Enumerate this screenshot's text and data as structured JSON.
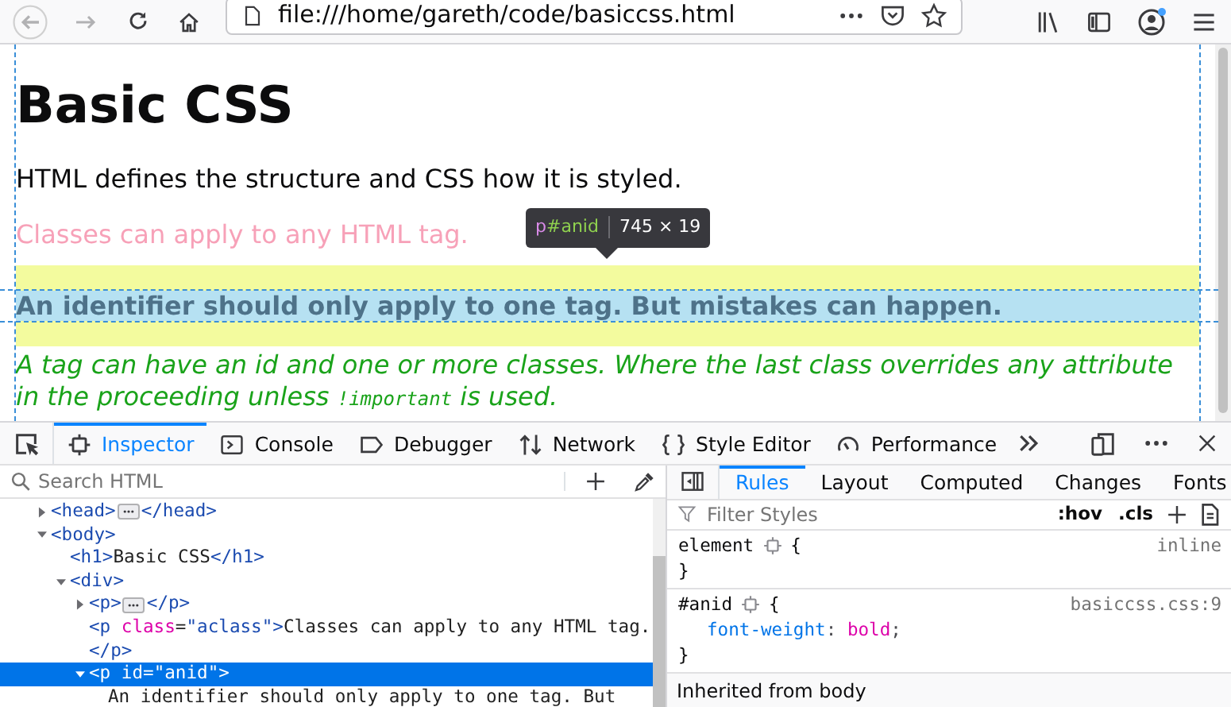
{
  "browser": {
    "url": "file:///home/gareth/code/basiccss.html"
  },
  "page": {
    "heading": "Basic CSS",
    "paragraphs": [
      {
        "kind": "plain",
        "text": "HTML defines the structure and CSS how it is styled."
      },
      {
        "kind": "class",
        "text": "Classes can apply to any HTML tag."
      },
      {
        "kind": "id",
        "text": "An identifier should only apply to one tag. But mistakes can happen.",
        "highlighted": true
      },
      {
        "kind": "mixed",
        "parts": [
          {
            "kind": "text",
            "text": "A tag can have an id and one or more classes. Where the last class overrides any attribute in the proceeding unless "
          },
          {
            "kind": "code",
            "text": "!important"
          },
          {
            "kind": "text",
            "text": " is used."
          }
        ]
      }
    ]
  },
  "tooltip": {
    "tag": "p",
    "id": "#anid",
    "size": "745 × 19"
  },
  "devtools": {
    "tabs": [
      {
        "label": "Inspector",
        "selected": true
      },
      {
        "label": "Console",
        "selected": false
      },
      {
        "label": "Debugger",
        "selected": false
      },
      {
        "label": "Network",
        "selected": false
      },
      {
        "label": "Style Editor",
        "selected": false
      },
      {
        "label": "Performance",
        "selected": false
      }
    ],
    "markup": {
      "search_placeholder": "Search HTML",
      "tree": [
        {
          "segs": [
            {
              "kind": "tag",
              "text": "<head>"
            },
            {
              "kind": "more"
            },
            {
              "kind": "tag",
              "text": "</head>"
            }
          ],
          "expanded": false,
          "selected": false
        },
        {
          "segs": [
            {
              "kind": "tag",
              "text": "<body>"
            }
          ],
          "expanded": true,
          "selected": false,
          "children": [
            {
              "segs": [
                {
                  "kind": "tag",
                  "text": "<h1>"
                },
                {
                  "kind": "text",
                  "text": "Basic CSS"
                },
                {
                  "kind": "tag",
                  "text": "</h1>"
                }
              ],
              "selected": false
            },
            {
              "segs": [
                {
                  "kind": "tag",
                  "text": "<div>"
                }
              ],
              "expanded": true,
              "selected": false,
              "children": [
                {
                  "segs": [
                    {
                      "kind": "tag",
                      "text": "<p>"
                    },
                    {
                      "kind": "more"
                    },
                    {
                      "kind": "tag",
                      "text": "</p>"
                    }
                  ],
                  "expanded": false,
                  "selected": false
                },
                {
                  "segs": [
                    {
                      "kind": "tag",
                      "text": "<p "
                    },
                    {
                      "kind": "attr",
                      "text": "class"
                    },
                    {
                      "kind": "text",
                      "text": "="
                    },
                    {
                      "kind": "val",
                      "text": "\"aclass\""
                    },
                    {
                      "kind": "tag",
                      "text": ">"
                    },
                    {
                      "kind": "text",
                      "text": "Classes can apply to any HTML tag."
                    }
                  ],
                  "selected": false
                },
                {
                  "segs": [
                    {
                      "kind": "tag",
                      "text": "</p>"
                    }
                  ],
                  "selected": false
                },
                {
                  "segs": [
                    {
                      "kind": "tag",
                      "text": "<p "
                    },
                    {
                      "kind": "attr",
                      "text": "id"
                    },
                    {
                      "kind": "text",
                      "text": "="
                    },
                    {
                      "kind": "val",
                      "text": "\"anid\""
                    },
                    {
                      "kind": "tag",
                      "text": ">"
                    }
                  ],
                  "expanded": true,
                  "selected": true,
                  "children": [
                    {
                      "segs": [
                        {
                          "kind": "text",
                          "text": "An identifier should only apply to one tag. But"
                        }
                      ],
                      "selected": false
                    }
                  ]
                }
              ]
            }
          ]
        }
      ]
    },
    "rules": {
      "tabs": [
        {
          "label": "Rules",
          "selected": true
        },
        {
          "label": "Layout",
          "selected": false
        },
        {
          "label": "Computed",
          "selected": false
        },
        {
          "label": "Changes",
          "selected": false
        },
        {
          "label": "Fonts",
          "selected": false
        }
      ],
      "filter_placeholder": "Filter Styles",
      "buttons": [
        ":hov",
        ".cls"
      ],
      "rules": [
        {
          "selector": "element",
          "open": "{",
          "close": "}",
          "source": "inline"
        },
        {
          "selector": "#anid",
          "open": "{",
          "close": "}",
          "source": "basiccss.css:9",
          "declarations": [
            {
              "property": "font-weight",
              "colon": ":",
              "value": "bold",
              "semicolon": ";"
            }
          ]
        }
      ],
      "inherited_header": "Inherited from body"
    }
  }
}
